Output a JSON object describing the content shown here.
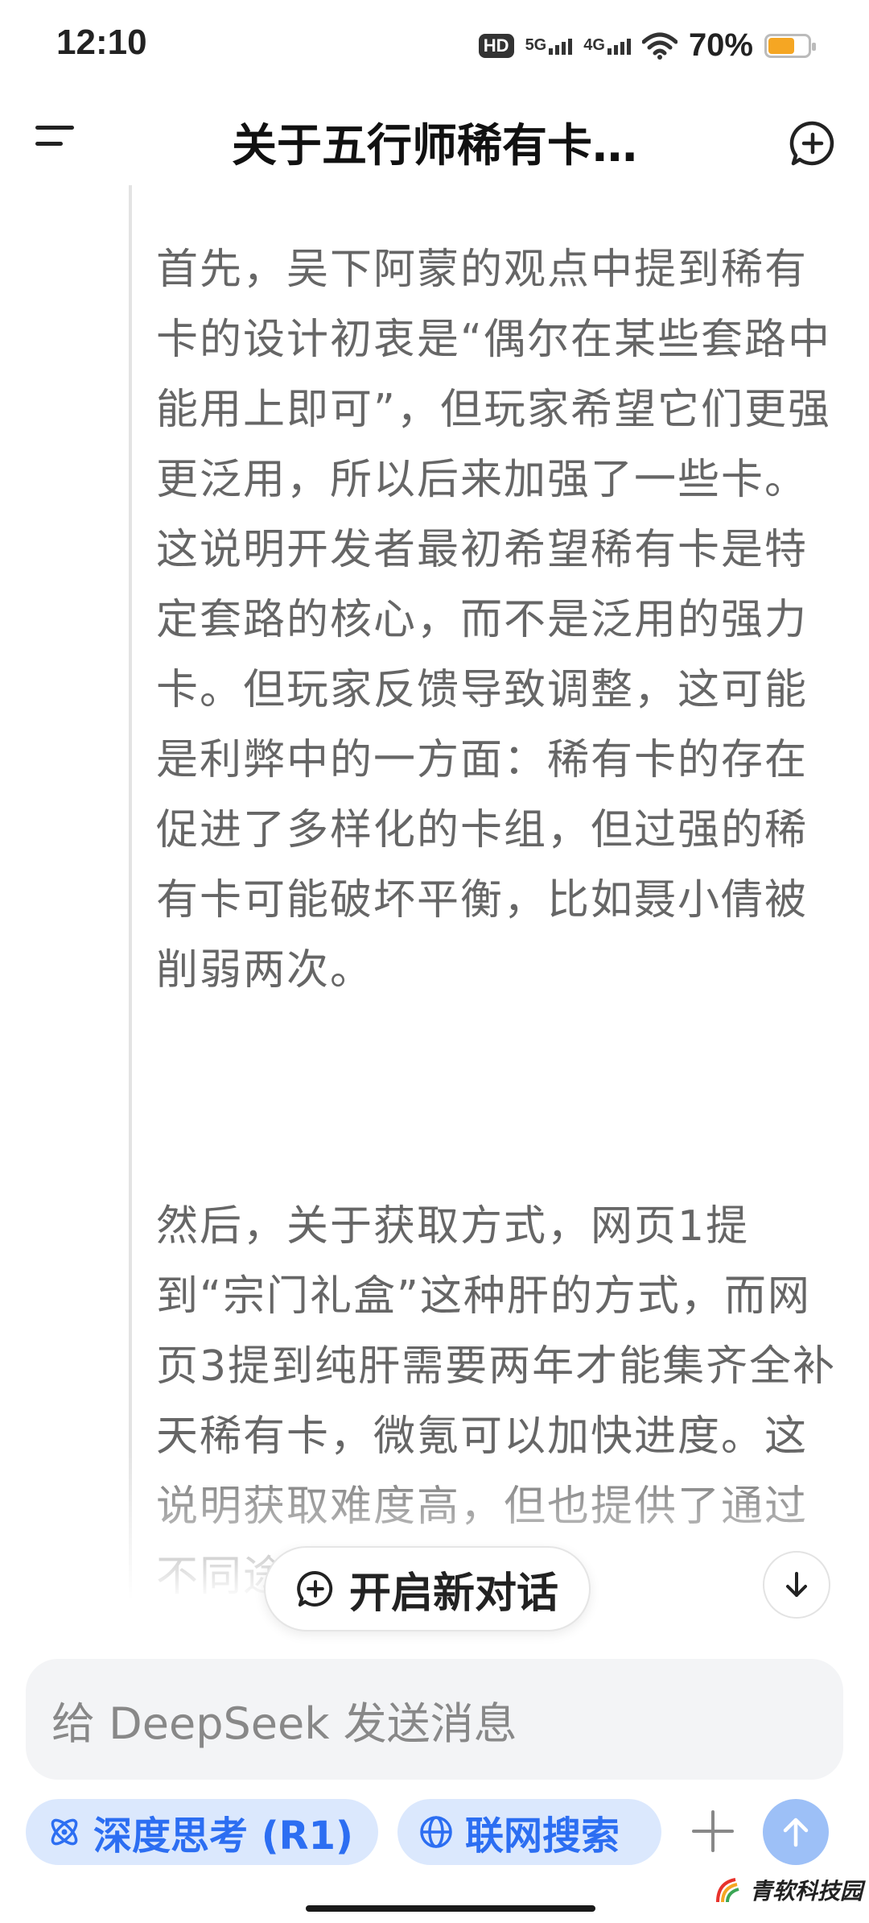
{
  "status_bar": {
    "time": "12:10",
    "hd": "HD",
    "net1": "5G",
    "net2": "4G",
    "battery_percent": "70%",
    "battery_level": 0.7
  },
  "header": {
    "title": "关于五行师稀有卡…"
  },
  "thinking": {
    "paragraphs": [
      "首先，吴下阿蒙的观点中提到稀有卡的设计初衷是“偶尔在某些套路中能用上即可”，但玩家希望它们更强更泛用，所以后来加强了一些卡。这说明开发者最初希望稀有卡是特定套路的核心，而不是泛用的强力卡。但玩家反馈导致调整，这可能是利弊中的一方面：稀有卡的存在促进了多样化的卡组，但过强的稀有卡可能破坏平衡，比如聂小倩被削弱两次。",
      "然后，关于获取方式，网页1提到“宗门礼盒”这种肝的方式，而网页3提到纯肝需要两年才能集齐全补天稀有卡，微氪可以加快进度。这说明获取难度高，但也提供了通过不同途径"
    ]
  },
  "floating": {
    "new_chat_label": "开启新对话"
  },
  "composer": {
    "placeholder": "给 DeepSeek 发送消息",
    "deep_think_label": "深度思考 (R1)",
    "web_search_label": "联网搜索"
  },
  "watermark": {
    "text": "青软科技园"
  },
  "colors": {
    "accent": "#2c6ef2",
    "chip_bg": "#dbe8fd",
    "send_bg": "#9dc0f7",
    "battery": "#f5a623"
  }
}
